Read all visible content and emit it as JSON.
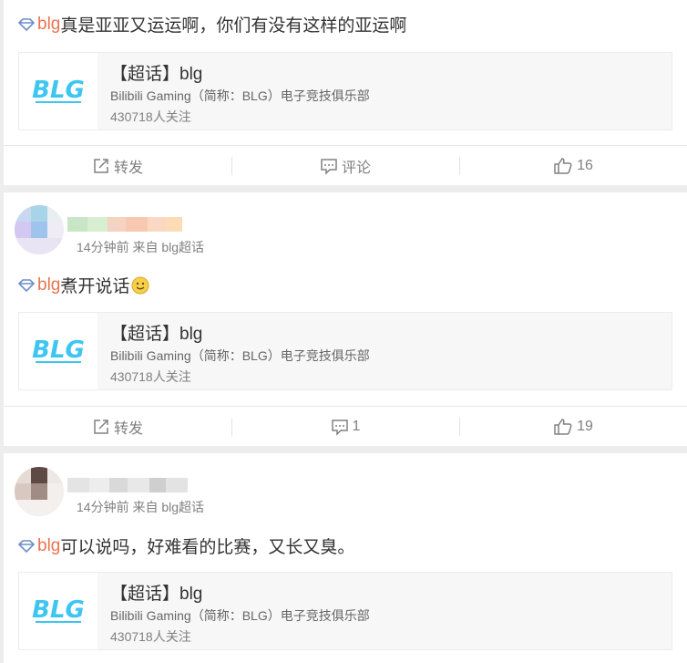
{
  "posts": [
    {
      "topic": "blg",
      "text": " 真是亚亚又运运啊，你们有没有这样的亚运啊",
      "topic_card": {
        "logo_text": "BLG",
        "title": "【超话】blg",
        "description": "Bilibili Gaming（简称：BLG）电子竞技俱乐部",
        "followers": "430718人关注"
      },
      "actions": {
        "repost": "转发",
        "comment": "评论",
        "like": "16"
      }
    },
    {
      "meta": "14分钟前 来自 blg超话",
      "topic": "blg",
      "text": "煮开说话",
      "topic_card": {
        "logo_text": "BLG",
        "title": "【超话】blg",
        "description": "Bilibili Gaming（简称：BLG）电子竞技俱乐部",
        "followers": "430718人关注"
      },
      "actions": {
        "repost": "转发",
        "comment": "1",
        "like": "19"
      }
    },
    {
      "meta": "14分钟前 来自 blg超话",
      "topic": "blg",
      "text": " 可以说吗，好难看的比赛，又长又臭。",
      "topic_card": {
        "logo_text": "BLG",
        "title": "【超话】blg",
        "description": "Bilibili Gaming（简称：BLG）电子竞技俱乐部",
        "followers": "430718人关注"
      }
    }
  ],
  "colors": {
    "topic_link": "#eb7350",
    "logo": "#3ec6f0",
    "muted": "#808080"
  },
  "icons": [
    "diamond-icon",
    "smile-emoji-icon",
    "repost-icon",
    "comment-icon",
    "like-icon"
  ]
}
